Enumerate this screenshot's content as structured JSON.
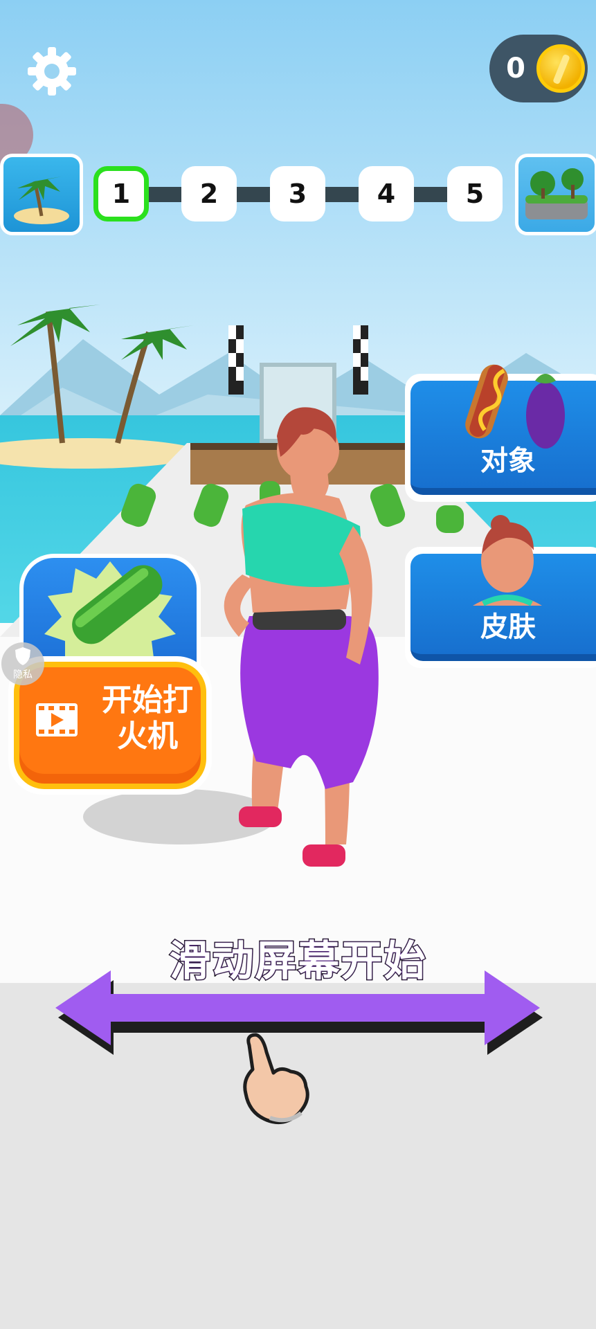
{
  "coins": {
    "count": "0"
  },
  "level_progress": {
    "steps": [
      "1",
      "2",
      "3",
      "4",
      "5"
    ],
    "current_step": "1"
  },
  "side_panels": {
    "objects_label": "对象",
    "skin_label": "皮肤"
  },
  "powerup": {
    "label_line1": "开始打",
    "label_line2": "火机"
  },
  "privacy": {
    "label": "隐私"
  },
  "hint": {
    "text": "滑动屏幕开始"
  },
  "icons": [
    "gear-icon",
    "coin-icon",
    "island-start-icon",
    "island-end-icon",
    "hotdog-icon",
    "eggplant-icon",
    "character-face-icon",
    "cucumber-icon",
    "film-icon",
    "shield-icon",
    "double-arrow-icon",
    "pointing-hand-icon"
  ],
  "colors": {
    "progress_current": "#2be01e",
    "panel_blue": "#1f8ee8",
    "powerup_orange": "#ff7711",
    "arrow_purple": "#a05cf0",
    "coin_pill": "#3e5566"
  }
}
